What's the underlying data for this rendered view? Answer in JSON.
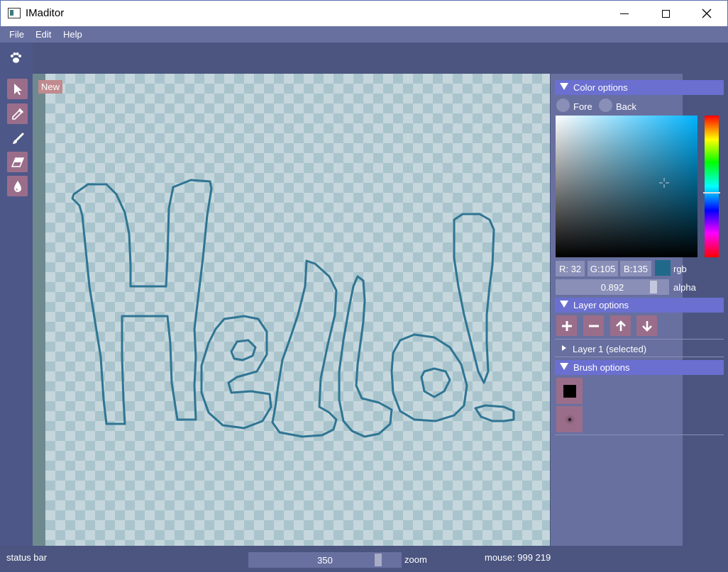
{
  "window": {
    "title": "IMaditor"
  },
  "menu": {
    "items": [
      "File",
      "Edit",
      "Help"
    ]
  },
  "canvas": {
    "badge": "New"
  },
  "color_options": {
    "header": "Color options",
    "fore_label": "Fore",
    "back_label": "Back",
    "r": "R: 32",
    "g": "G:105",
    "b": "B:135",
    "mode_label": "rgb",
    "alpha_value": "0.892",
    "alpha_label": "alpha",
    "swatch_color": "#20698b"
  },
  "layer_options": {
    "header": "Layer options",
    "layers": [
      "Layer 1 (selected)"
    ]
  },
  "brush_options": {
    "header": "Brush options"
  },
  "status": {
    "text": "status bar",
    "zoom_value": "350",
    "zoom_label": "zoom",
    "mouse": "mouse: 999 219"
  }
}
